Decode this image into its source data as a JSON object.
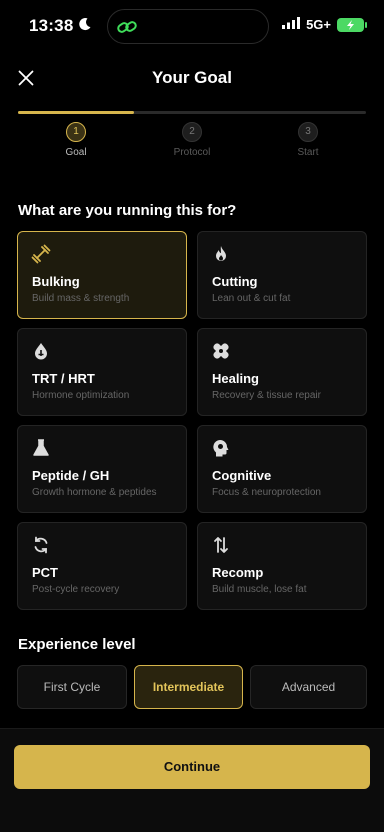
{
  "status": {
    "time": "13:38",
    "network": "5G+"
  },
  "header": {
    "title": "Your Goal"
  },
  "progress": {
    "fraction": 0.333
  },
  "steps": [
    {
      "number": "1",
      "label": "Goal",
      "active": true
    },
    {
      "number": "2",
      "label": "Protocol",
      "active": false
    },
    {
      "number": "3",
      "label": "Start",
      "active": false
    }
  ],
  "question": "What are you running this for?",
  "goals": [
    {
      "name": "Bulking",
      "desc": "Build mass & strength",
      "icon": "dumbbell-icon",
      "selected": true
    },
    {
      "name": "Cutting",
      "desc": "Lean out & cut fat",
      "icon": "flame-icon",
      "selected": false
    },
    {
      "name": "TRT / HRT",
      "desc": "Hormone optimization",
      "icon": "drop-icon",
      "selected": false
    },
    {
      "name": "Healing",
      "desc": "Recovery & tissue repair",
      "icon": "bandage-icon",
      "selected": false
    },
    {
      "name": "Peptide / GH",
      "desc": "Growth hormone & peptides",
      "icon": "flask-icon",
      "selected": false
    },
    {
      "name": "Cognitive",
      "desc": "Focus & neuroprotection",
      "icon": "brain-icon",
      "selected": false
    },
    {
      "name": "PCT",
      "desc": "Post-cycle recovery",
      "icon": "cycle-icon",
      "selected": false
    },
    {
      "name": "Recomp",
      "desc": "Build muscle, lose fat",
      "icon": "swap-arrows-icon",
      "selected": false
    }
  ],
  "experience": {
    "heading": "Experience level",
    "options": [
      "First Cycle",
      "Intermediate",
      "Advanced"
    ],
    "selected": "Intermediate"
  },
  "footer": {
    "continue_label": "Continue"
  },
  "colors": {
    "accent": "#d6b54c",
    "background": "#000000",
    "card": "#0f0f0f"
  }
}
